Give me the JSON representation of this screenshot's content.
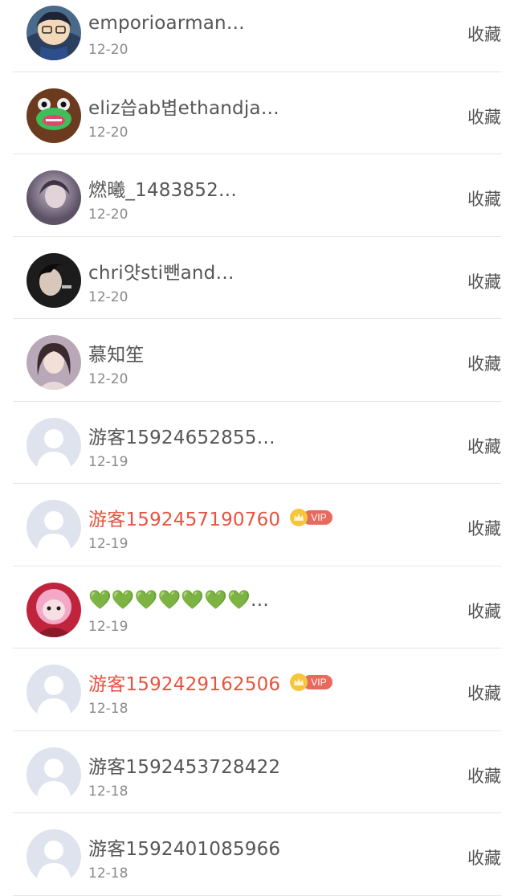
{
  "favorites": [
    {
      "name": "emporioarman…",
      "date": "12-20",
      "action": "收藏",
      "vip": false,
      "avatar": "anime-avatar"
    },
    {
      "name": "eliz씁ab볍ethandja…",
      "date": "12-20",
      "action": "收藏",
      "vip": false,
      "avatar": "frog-avatar"
    },
    {
      "name": "燃曦_1483852…",
      "date": "12-20",
      "action": "收藏",
      "vip": false,
      "avatar": "photo-avatar"
    },
    {
      "name": "chri얏sti뺀and…",
      "date": "12-20",
      "action": "收藏",
      "vip": false,
      "avatar": "photo-avatar"
    },
    {
      "name": "慕知笙",
      "date": "12-20",
      "action": "收藏",
      "vip": false,
      "avatar": "photo-avatar"
    },
    {
      "name": "游客15924652855…",
      "date": "12-19",
      "action": "收藏",
      "vip": false,
      "avatar": "default-avatar"
    },
    {
      "name": "游客1592457190760",
      "date": "12-19",
      "action": "收藏",
      "vip": true,
      "vip_label": "VIP",
      "avatar": "default-avatar"
    },
    {
      "name": "💚💚💚💚💚💚💚…",
      "date": "12-19",
      "action": "收藏",
      "vip": false,
      "avatar": "photo-avatar"
    },
    {
      "name": "游客1592429162506",
      "date": "12-18",
      "action": "收藏",
      "vip": true,
      "vip_label": "VIP",
      "avatar": "default-avatar"
    },
    {
      "name": "游客1592453728422",
      "date": "12-18",
      "action": "收藏",
      "vip": false,
      "avatar": "default-avatar"
    },
    {
      "name": "游客1592401085966",
      "date": "12-18",
      "action": "收藏",
      "vip": false,
      "avatar": "default-avatar"
    }
  ],
  "colors": {
    "vip_name": "#e8533f",
    "vip_pill": "#e86a5c",
    "crown": "#f6c53a",
    "default_avatar_bg": "#dfe3ee",
    "default_avatar_fg": "#ffffff"
  }
}
